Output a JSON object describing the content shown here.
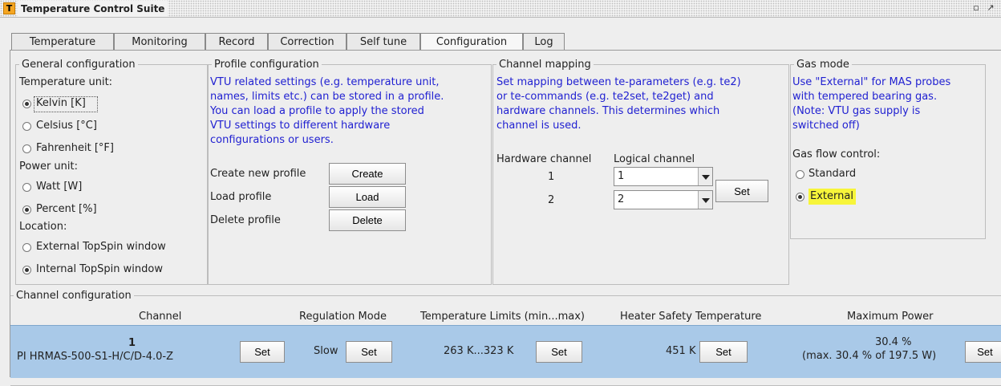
{
  "window": {
    "app_icon": "T",
    "title": "Temperature Control Suite",
    "restore_icon": "restore-icon",
    "maximize_icon": "maximize-icon"
  },
  "tabs": [
    {
      "label": "Temperature",
      "active": false
    },
    {
      "label": "Monitoring",
      "active": false
    },
    {
      "label": "Record",
      "active": false
    },
    {
      "label": "Correction",
      "active": false
    },
    {
      "label": "Self tune",
      "active": false
    },
    {
      "label": "Configuration",
      "active": true
    },
    {
      "label": "Log",
      "active": false
    }
  ],
  "general": {
    "legend": "General configuration",
    "temp_unit_label": "Temperature unit:",
    "temp_units": [
      {
        "label": "Kelvin [K]",
        "selected": true
      },
      {
        "label": "Celsius [°C]",
        "selected": false
      },
      {
        "label": "Fahrenheit [°F]",
        "selected": false
      }
    ],
    "power_unit_label": "Power unit:",
    "power_units": [
      {
        "label": "Watt [W]",
        "selected": false
      },
      {
        "label": "Percent [%]",
        "selected": true
      }
    ],
    "location_label": "Location:",
    "locations": [
      {
        "label": "External TopSpin window",
        "selected": false
      },
      {
        "label": "Internal TopSpin window",
        "selected": true
      }
    ]
  },
  "profile": {
    "legend": "Profile configuration",
    "desc_lines": [
      "VTU related settings (e.g. temperature unit,",
      "names, limits etc.) can be stored in a profile.",
      "You can load a profile to apply the stored",
      "VTU settings to different hardware",
      "configurations or users."
    ],
    "create_label": "Create new profile",
    "create_button": "Create",
    "load_label": "Load profile",
    "load_button": "Load",
    "delete_label": "Delete profile",
    "delete_button": "Delete"
  },
  "mapping": {
    "legend": "Channel mapping",
    "desc_lines": [
      "Set mapping between te-parameters (e.g. te2)",
      "or te-commands (e.g. te2set, te2get) and",
      "hardware channels. This determines which",
      "channel is used."
    ],
    "hw_header": "Hardware channel",
    "logical_header": "Logical channel",
    "rows": [
      {
        "hw": "1",
        "logical": "1"
      },
      {
        "hw": "2",
        "logical": "2"
      }
    ],
    "set_button": "Set"
  },
  "gas": {
    "legend": "Gas mode",
    "desc_lines": [
      "Use \"External\" for MAS probes",
      "with tempered bearing gas.",
      "(Note: VTU gas supply is",
      "switched off)"
    ],
    "flow_label": "Gas flow control:",
    "options": [
      {
        "label": "Standard",
        "selected": false
      },
      {
        "label": "External",
        "selected": true
      }
    ]
  },
  "channel_config": {
    "legend": "Channel configuration",
    "headers": {
      "channel": "Channel",
      "regulation": "Regulation Mode",
      "limits": "Temperature Limits (min...max)",
      "safety": "Heater Safety Temperature",
      "power": "Maximum Power"
    },
    "row": {
      "number": "1",
      "probe": "PI HRMAS-500-S1-H/C/D-4.0-Z",
      "set1": "Set",
      "regulation": "Slow",
      "set2": "Set",
      "limits": "263 K...323 K",
      "set3": "Set",
      "safety": "451 K",
      "set4": "Set",
      "power": "30.4 %",
      "power_detail": "(max. 30.4 % of 197.5 W)",
      "set5": "Set"
    }
  },
  "colors": {
    "info_text": "#1f1fd1",
    "row_selected": "#a9c9e8",
    "highlight": "#f7f53a"
  }
}
